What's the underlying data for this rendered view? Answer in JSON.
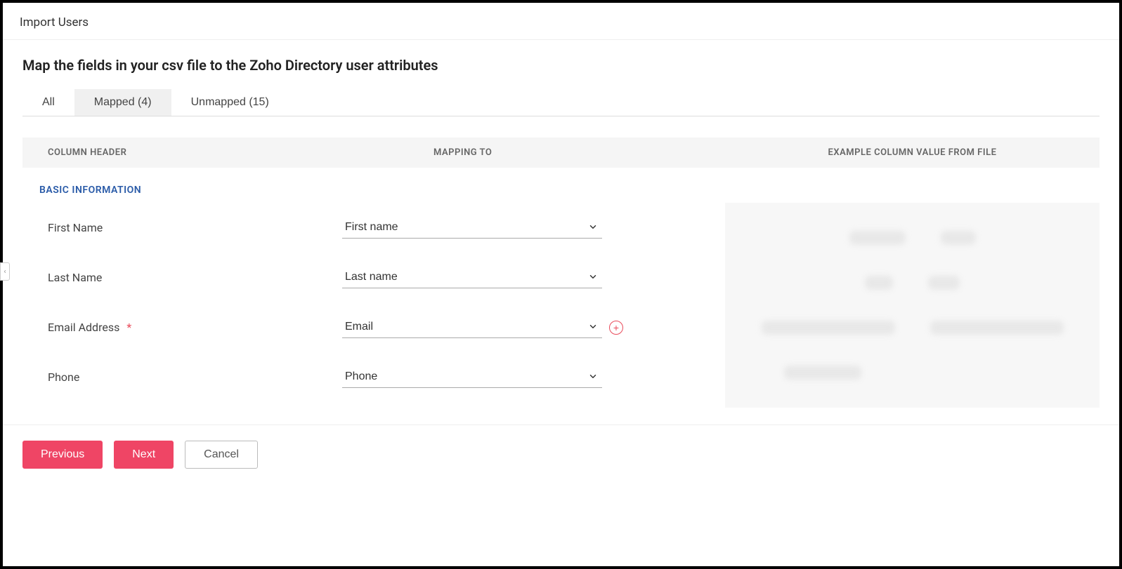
{
  "header": {
    "title": "Import Users"
  },
  "subtitle": "Map the fields in your csv file to the Zoho Directory user attributes",
  "tabs": {
    "all": "All",
    "mapped": "Mapped (4)",
    "unmapped": "Unmapped (15)"
  },
  "columns": {
    "header1": "COLUMN HEADER",
    "header2": "MAPPING TO",
    "header3": "EXAMPLE COLUMN VALUE FROM FILE"
  },
  "section": {
    "title": "BASIC INFORMATION"
  },
  "fields": {
    "first_name": {
      "label": "First Name",
      "value": "First name"
    },
    "last_name": {
      "label": "Last Name",
      "value": "Last name"
    },
    "email": {
      "label": "Email Address",
      "value": "Email"
    },
    "phone": {
      "label": "Phone",
      "value": "Phone"
    }
  },
  "buttons": {
    "previous": "Previous",
    "next": "Next",
    "cancel": "Cancel"
  },
  "icons": {
    "plus": "+",
    "handle": "‹"
  }
}
